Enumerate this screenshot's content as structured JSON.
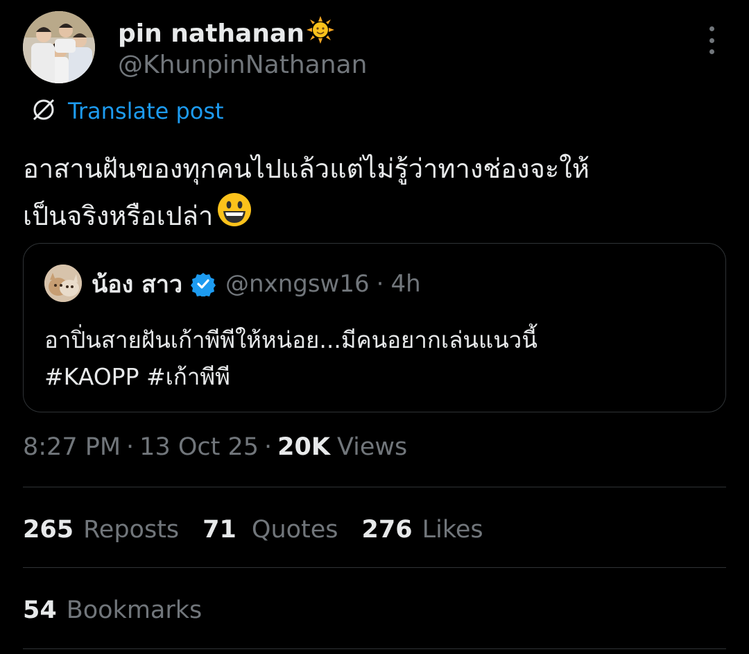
{
  "author": {
    "display_name": "pin nathanan",
    "handle": "@KhunpinNathanan",
    "name_emoji": "sun-emoji-icon"
  },
  "translate_label": "Translate post",
  "post": {
    "text_line1": "อาสานฝันของทุกคนไปแล้วแต่ไม่รู้ว่าทางช่องจะให้",
    "text_line2": "เป็นจริงหรือเปล่า",
    "emoji": "grinning-face-icon"
  },
  "quoted": {
    "name": "น้อง สาว",
    "handle": "@nxngsw16",
    "time": "4h",
    "separator": "·",
    "verified_color": "#1d9bf0",
    "text_line1": "อาปิ่นสายฝันเก้าพีพีให้หน่อย...มีคนอยากเล่นแนวนี้",
    "text_line2": "#KAOPP #เก้าพีพี"
  },
  "meta": {
    "time": "8:27 PM",
    "date": "13 Oct 25",
    "separator": "·",
    "views_count": "20K",
    "views_label": "Views"
  },
  "stats": {
    "reposts_count": "265",
    "reposts_label": "Reposts",
    "quotes_count": "71",
    "quotes_label": "Quotes",
    "likes_count": "276",
    "likes_label": "Likes",
    "bookmarks_count": "54",
    "bookmarks_label": "Bookmarks"
  },
  "colors": {
    "background": "#000000",
    "text_primary": "#e7e9ea",
    "text_secondary": "#71767b",
    "link": "#1d9bf0",
    "border": "#2f3336"
  }
}
